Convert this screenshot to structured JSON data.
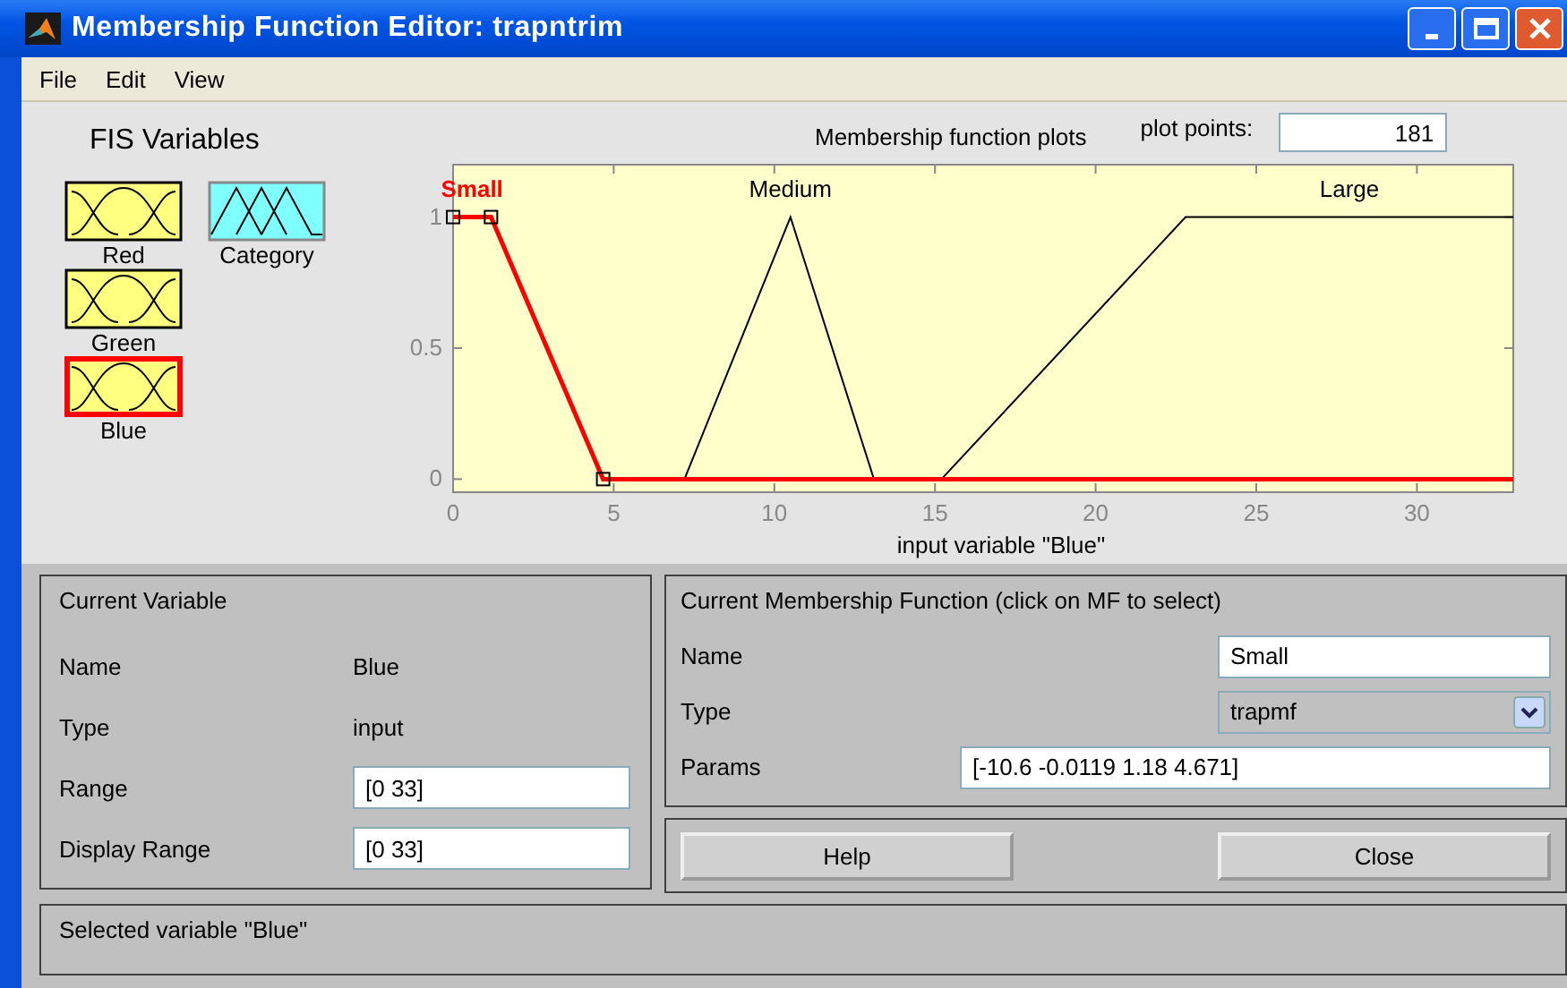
{
  "window": {
    "title": "Membership Function Editor: trapntrim"
  },
  "menu": [
    "File",
    "Edit",
    "View"
  ],
  "fis_variables": {
    "title": "FIS Variables",
    "items": [
      {
        "name": "Red",
        "kind": "input",
        "selected": false
      },
      {
        "name": "Category",
        "kind": "output",
        "selected": false
      },
      {
        "name": "Green",
        "kind": "input",
        "selected": false
      },
      {
        "name": "Blue",
        "kind": "input",
        "selected": true
      }
    ]
  },
  "plot": {
    "title": "Membership function plots",
    "plot_points_label": "plot points:",
    "plot_points": "181",
    "chart_data": {
      "type": "line",
      "xlabel": "input variable \"Blue\"",
      "x": [
        0,
        1.18,
        4.671,
        7.2,
        10.5,
        13.1,
        15.2,
        22.8,
        33
      ],
      "series": [
        {
          "name": "Small",
          "color": "#ff0000",
          "values": [
            1,
            1,
            0,
            0,
            0,
            0,
            0,
            0,
            0
          ]
        },
        {
          "name": "Medium",
          "color": "#000000",
          "values": [
            null,
            null,
            null,
            0,
            1,
            0,
            null,
            null,
            null
          ]
        },
        {
          "name": "Large",
          "color": "#000000",
          "values": [
            null,
            null,
            null,
            null,
            null,
            null,
            0,
            1,
            1
          ]
        }
      ],
      "xlim": [
        0,
        33
      ],
      "ylim": [
        -0.05,
        1.2
      ],
      "xticks": [
        0,
        5,
        10,
        15,
        20,
        25,
        30
      ],
      "yticks": [
        0,
        0.5,
        1
      ]
    },
    "curves": [
      {
        "selected": true
      },
      {
        "selected": false
      },
      {
        "selected": false
      }
    ]
  },
  "current_variable": {
    "title": "Current Variable",
    "name_label": "Name",
    "name": "Blue",
    "type_label": "Type",
    "type": "input",
    "range_label": "Range",
    "range": "[0 33]",
    "display_range_label": "Display Range",
    "display_range": "[0 33]"
  },
  "current_mf": {
    "title": "Current Membership Function (click on MF to select)",
    "name_label": "Name",
    "name": "Small",
    "type_label": "Type",
    "type": "trapmf",
    "params_label": "Params",
    "params": "[-10.6 -0.0119 1.18 4.671]"
  },
  "buttons": [
    "Help",
    "Close"
  ],
  "status_bar": "Selected variable \"Blue\""
}
